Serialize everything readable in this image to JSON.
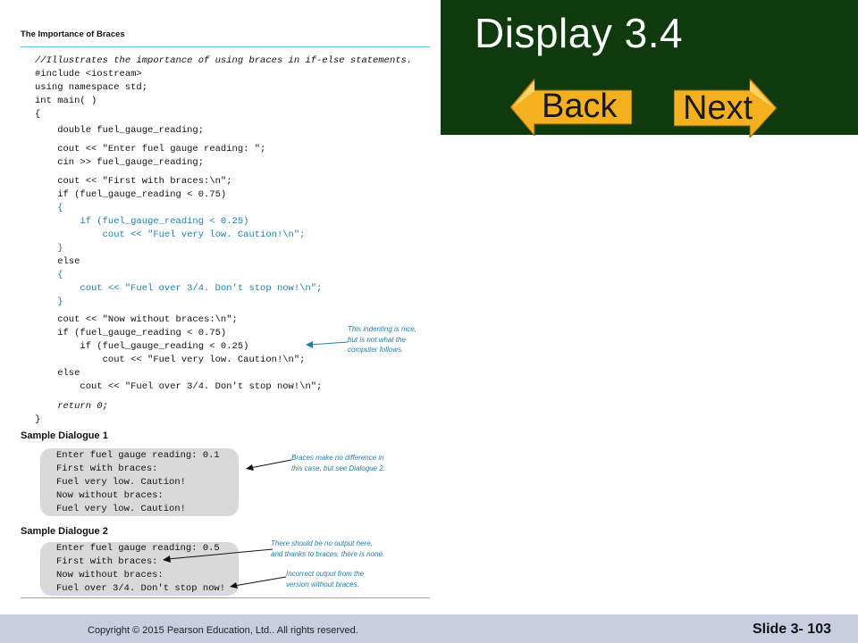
{
  "slide": {
    "title": "Display 3.4",
    "back_label": "Back",
    "next_label": "Next",
    "copyright": "Copyright © 2015 Pearson Education, Ltd..  All rights reserved.",
    "slide_number": "Slide 3- 103"
  },
  "colors": {
    "title_bg": "#0e3a0e",
    "button_fill": "#f5b020",
    "annotation_blue": "#1d7fb0",
    "footer_bg": "#c9cde0"
  },
  "figure": {
    "heading": "The Importance of Braces",
    "code_lines": [
      "//Illustrates the importance of using braces in if-else statements.",
      "#include <iostream>",
      "using namespace std;",
      "int main( )",
      "{",
      "    double fuel_gauge_reading;",
      "    cout << \"Enter fuel gauge reading: \";",
      "    cin >> fuel_gauge_reading;",
      "    cout << \"First with braces:\\n\";",
      "    if (fuel_gauge_reading < 0.75)",
      "    {",
      "        if (fuel_gauge_reading < 0.25)",
      "            cout << \"Fuel very low. Caution!\\n\";",
      "    }",
      "    else",
      "    {",
      "        cout << \"Fuel over 3/4. Don't stop now!\\n\";",
      "    }",
      "    cout << \"Now without braces:\\n\";",
      "    if (fuel_gauge_reading < 0.75)",
      "        if (fuel_gauge_reading < 0.25)",
      "            cout << \"Fuel very low. Caution!\\n\";",
      "    else",
      "        cout << \"Fuel over 3/4. Don't stop now!\\n\";",
      "    return 0;",
      "}"
    ],
    "note_indent": [
      "This indenting is nice,",
      "but is not what the",
      "computer follows."
    ],
    "dialogue1_title": "Sample Dialogue 1",
    "dialogue1_lines": [
      "Enter fuel gauge reading: 0.1",
      "First with braces:",
      "Fuel very low. Caution!",
      "Now without braces:",
      "Fuel very low. Caution!"
    ],
    "note_dialogue1": [
      "Braces make no difference in",
      "this case, but see Dialogue 2."
    ],
    "dialogue2_title": "Sample Dialogue 2",
    "dialogue2_lines": [
      "Enter fuel gauge reading: 0.5",
      "First with braces:",
      "Now without braces:",
      "Fuel over 3/4. Don't stop now!"
    ],
    "note_dialogue2a": [
      "There should be no output here,",
      "and thanks to braces, there is none."
    ],
    "note_dialogue2b": [
      "Incorrect output from the",
      "version without braces."
    ]
  }
}
